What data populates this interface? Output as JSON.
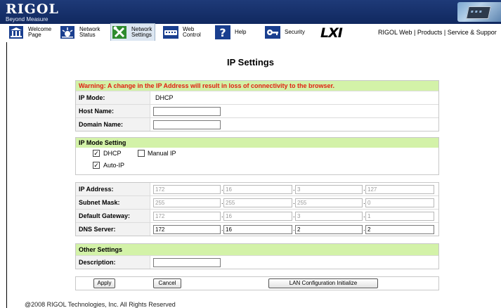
{
  "logo": {
    "main": "RIGOL",
    "sub": "Beyond Measure"
  },
  "nav": [
    {
      "label": "Welcome\nPage"
    },
    {
      "label": "Network\nStatus"
    },
    {
      "label": "Network\nSettings"
    },
    {
      "label": "Web\nControl"
    },
    {
      "label": "Help"
    },
    {
      "label": "Security"
    }
  ],
  "lxi_logo": "LXI",
  "top_links": "RIGOL Web | Products | Service & Suppor",
  "page_title": "IP Settings",
  "warning": "Warning: A change in the IP Address will result in loss of connectivity to the browser.",
  "general": {
    "ip_mode_label": "IP Mode:",
    "ip_mode_value": "DHCP",
    "host_name_label": "Host Name:",
    "host_name_value": "",
    "domain_name_label": "Domain Name:",
    "domain_name_value": ""
  },
  "ip_mode_setting": {
    "title": "IP Mode Setting",
    "dhcp": {
      "label": "DHCP",
      "checked": true
    },
    "manual_ip": {
      "label": "Manual IP",
      "checked": false
    },
    "auto_ip": {
      "label": "Auto-IP",
      "checked": true
    }
  },
  "addresses": {
    "ip_address": {
      "label": "IP Address:",
      "octets": [
        "172",
        "16",
        "3",
        "127"
      ],
      "enabled": false
    },
    "subnet_mask": {
      "label": "Subnet Mask:",
      "octets": [
        "255",
        "255",
        "255",
        "0"
      ],
      "enabled": false
    },
    "default_gateway": {
      "label": "Default Gateway:",
      "octets": [
        "172",
        "16",
        "3",
        "1"
      ],
      "enabled": false
    },
    "dns_server": {
      "label": "DNS Server:",
      "octets": [
        "172",
        "16",
        "2",
        "2"
      ],
      "enabled": true
    }
  },
  "other_settings": {
    "title": "Other Settings",
    "description_label": "Description:",
    "description_value": ""
  },
  "buttons": {
    "apply": "Apply",
    "cancel": "Cancel",
    "lan_init": "LAN Configuration Initialize"
  },
  "footer": "@2008 RIGOL Technologies, Inc. All Rights Reserved",
  "colors": {
    "header_bg": "#1e3a78",
    "section_head": "#d3f2a8",
    "warning": "#e02010"
  }
}
